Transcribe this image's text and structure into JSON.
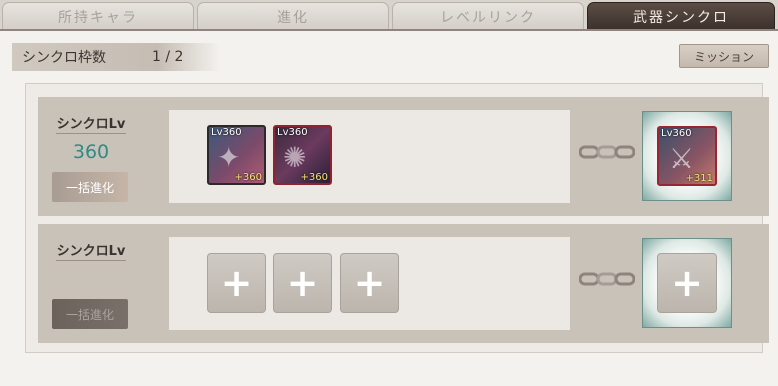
{
  "tabs": [
    {
      "label": "所持キャラ",
      "active": false
    },
    {
      "label": "進化",
      "active": false
    },
    {
      "label": "レベルリンク",
      "active": false
    },
    {
      "label": "武器シンクロ",
      "active": true
    }
  ],
  "sync_slots": {
    "label": "シンクロ枠数",
    "value": "1 / 2"
  },
  "mission_button": "ミッション",
  "rows": [
    {
      "sync_lv_label": "シンクロLv",
      "sync_lv_value": "360",
      "bulk_evolve": "一括進化",
      "materials": [
        {
          "lv": "Lv360",
          "plus": "+360",
          "frame": "blue",
          "icon": "crossbow-weapon-icon"
        },
        {
          "lv": "Lv360",
          "plus": "+360",
          "frame": "red",
          "icon": "dark-orb-weapon-icon"
        }
      ],
      "result": {
        "lv": "Lv360",
        "plus": "+311",
        "icon": "sword-weapon-icon"
      }
    },
    {
      "sync_lv_label": "シンクロLv",
      "sync_lv_value": "",
      "bulk_evolve": "一括進化",
      "empty_slots": 3,
      "add_symbol": "+"
    }
  ],
  "colors": {
    "accent_teal": "#2f8c85",
    "tab_active": "#3b302b",
    "card_red": "#8e2432"
  }
}
